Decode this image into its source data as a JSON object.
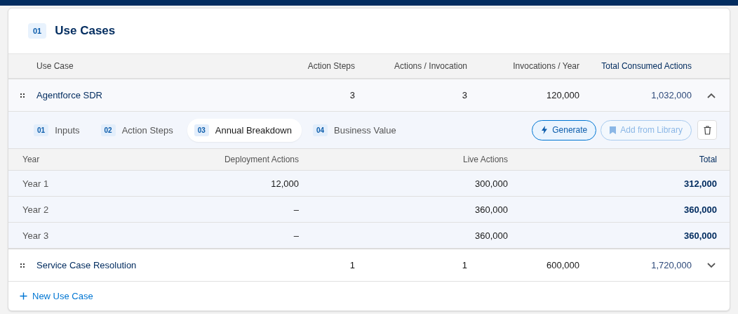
{
  "section": {
    "number": "01",
    "title": "Use Cases"
  },
  "table": {
    "columns": [
      "Use Case",
      "Action Steps",
      "Actions / Invocation",
      "Invocations / Year",
      "Total Consumed Actions"
    ],
    "rows": [
      {
        "name": "Agentforce SDR",
        "action_steps": "3",
        "actions_per_invocation": "3",
        "invocations_per_year": "120,000",
        "total": "1,032,000",
        "expanded": true,
        "detail": {
          "tabs": [
            {
              "number": "01",
              "label": "Inputs",
              "selected": false
            },
            {
              "number": "02",
              "label": "Action Steps",
              "selected": false
            },
            {
              "number": "03",
              "label": "Annual Breakdown",
              "selected": true
            },
            {
              "number": "04",
              "label": "Business Value",
              "selected": false
            }
          ],
          "buttons": [
            {
              "kind": "generate",
              "label": "Generate",
              "disabled": false
            },
            {
              "kind": "library",
              "label": "Add from Library",
              "disabled": true
            },
            {
              "kind": "delete",
              "disabled": false
            }
          ],
          "breakdown": {
            "columns": [
              "Year",
              "Deployment Actions",
              "Live Actions",
              "Total"
            ],
            "rows": [
              [
                "Year 1",
                "12,000",
                "300,000",
                "312,000"
              ],
              [
                "Year 2",
                "–",
                "360,000",
                "360,000"
              ],
              [
                "Year 3",
                "–",
                "360,000",
                "360,000"
              ]
            ]
          }
        }
      },
      {
        "name": "Service Case Resolution",
        "action_steps": "1",
        "actions_per_invocation": "1",
        "invocations_per_year": "600,000",
        "total": "1,720,000",
        "expanded": false
      }
    ]
  },
  "add_button": {
    "label": "New Use Case"
  }
}
